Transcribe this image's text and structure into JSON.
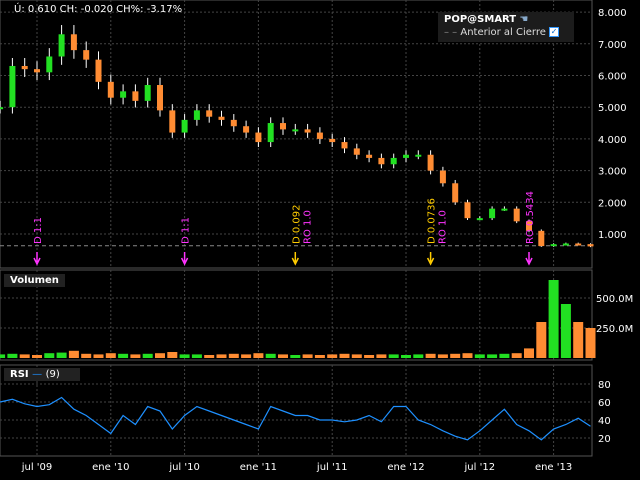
{
  "header": {
    "info": "Ú: 0.610 CH: -0.020 CH%: -3.17%"
  },
  "legend": {
    "symbol": "POP@SMART",
    "series": "Anterior al Cierre",
    "checked": true
  },
  "panels": {
    "volume_label": "Volumen",
    "rsi_label": "RSI",
    "rsi_period": "(9)"
  },
  "colors": {
    "up": "#22e022",
    "down": "#ff8c33",
    "rsi": "#1e90ff",
    "grid": "#444444",
    "dividend": "#ffcc00",
    "split": "#ff33ff"
  },
  "chart_data": [
    {
      "type": "candlestick",
      "ylim": [
        0,
        8
      ],
      "yticks": [
        "8.000",
        "7.000",
        "6.000",
        "5.000",
        "4.000",
        "3.000",
        "2.000",
        "1.000"
      ],
      "previous_close": 0.63,
      "x": [
        "2009-04",
        "2009-05",
        "2009-06",
        "2009-07",
        "2009-08",
        "2009-09",
        "2009-10",
        "2009-11",
        "2009-12",
        "2010-01",
        "2010-02",
        "2010-03",
        "2010-04",
        "2010-05",
        "2010-06",
        "2010-07",
        "2010-08",
        "2010-09",
        "2010-10",
        "2010-11",
        "2010-12",
        "2011-01",
        "2011-02",
        "2011-03",
        "2011-04",
        "2011-05",
        "2011-06",
        "2011-07",
        "2011-08",
        "2011-09",
        "2011-10",
        "2011-11",
        "2011-12",
        "2012-01",
        "2012-02",
        "2012-03",
        "2012-04",
        "2012-05",
        "2012-06",
        "2012-07",
        "2012-08",
        "2012-09",
        "2012-10",
        "2012-11",
        "2012-12",
        "2013-01",
        "2013-02",
        "2013-03",
        "2013-04"
      ],
      "close": [
        5.0,
        6.3,
        6.2,
        6.1,
        6.6,
        7.3,
        6.8,
        6.5,
        5.8,
        5.3,
        5.5,
        5.2,
        5.7,
        4.9,
        4.2,
        4.6,
        4.9,
        4.7,
        4.6,
        4.4,
        4.2,
        3.9,
        4.5,
        4.3,
        4.3,
        4.2,
        4.0,
        3.9,
        3.7,
        3.5,
        3.4,
        3.2,
        3.4,
        3.5,
        3.5,
        3.0,
        2.6,
        2.0,
        1.5,
        1.5,
        1.8,
        1.8,
        1.4,
        1.1,
        0.62,
        0.68,
        0.7,
        0.68,
        0.61
      ],
      "events": [
        {
          "date": "2009-07",
          "lines": [
            "D 1:1"
          ],
          "kind": "split"
        },
        {
          "date": "2010-07",
          "lines": [
            "D 1:1"
          ],
          "kind": "split"
        },
        {
          "date": "2011-04",
          "lines": [
            "D 0.092",
            "RO 1.0"
          ],
          "kind": "dividend"
        },
        {
          "date": "2012-03",
          "lines": [
            "D 0.0736",
            "RO 1.0"
          ],
          "kind": "dividend"
        },
        {
          "date": "2012-11",
          "lines": [
            "RO 0.5434"
          ],
          "kind": "split"
        }
      ]
    },
    {
      "type": "bar",
      "name": "Volumen",
      "yticks": [
        "500.0M",
        "250.0M"
      ],
      "ylim": [
        0,
        700
      ],
      "values": [
        30,
        35,
        30,
        25,
        40,
        45,
        60,
        35,
        30,
        40,
        35,
        30,
        35,
        40,
        50,
        30,
        30,
        25,
        30,
        35,
        30,
        40,
        35,
        30,
        25,
        30,
        25,
        30,
        35,
        30,
        25,
        30,
        30,
        25,
        30,
        35,
        30,
        35,
        40,
        30,
        30,
        35,
        40,
        80,
        300,
        650,
        450,
        300,
        250
      ]
    },
    {
      "type": "line",
      "name": "RSI (9)",
      "ylim": [
        0,
        100
      ],
      "yticks": [
        "80",
        "60",
        "40",
        "20"
      ],
      "values": [
        60,
        63,
        58,
        55,
        57,
        65,
        52,
        45,
        35,
        25,
        45,
        35,
        55,
        50,
        30,
        45,
        55,
        50,
        45,
        40,
        35,
        30,
        55,
        50,
        45,
        45,
        40,
        40,
        38,
        40,
        45,
        38,
        55,
        55,
        40,
        35,
        28,
        22,
        18,
        28,
        40,
        52,
        35,
        28,
        18,
        30,
        35,
        42,
        33
      ]
    }
  ],
  "xaxis": {
    "ticks": [
      {
        "date": "2009-07",
        "label": "jul '09"
      },
      {
        "date": "2010-01",
        "label": "ene '10"
      },
      {
        "date": "2010-07",
        "label": "jul '10"
      },
      {
        "date": "2011-01",
        "label": "ene '11"
      },
      {
        "date": "2011-07",
        "label": "jul '11"
      },
      {
        "date": "2012-01",
        "label": "ene '12"
      },
      {
        "date": "2012-07",
        "label": "jul '12"
      },
      {
        "date": "2013-01",
        "label": "ene '13"
      }
    ]
  }
}
